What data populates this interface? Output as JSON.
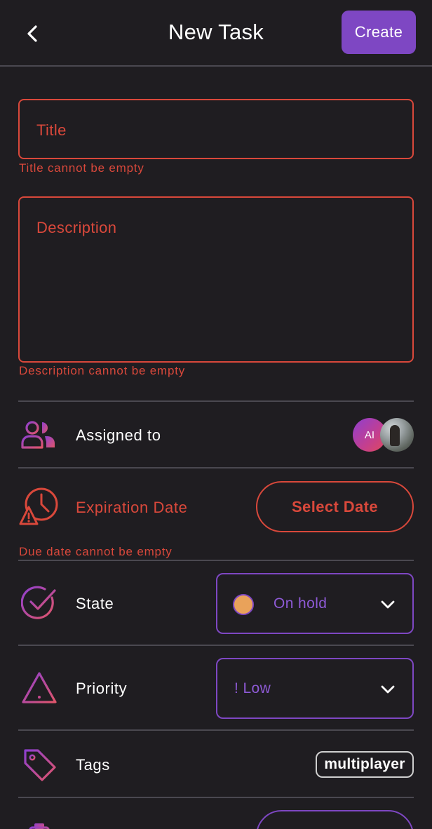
{
  "header": {
    "title": "New Task",
    "create_label": "Create"
  },
  "form": {
    "title_placeholder": "Title",
    "title_error": "Title cannot be empty",
    "description_placeholder": "Description",
    "description_error": "Description cannot be empty"
  },
  "assigned": {
    "label": "Assigned to",
    "avatar_initials": "AI"
  },
  "expiration": {
    "label": "Expiration Date",
    "button_label": "Select Date",
    "error": "Due date cannot be empty"
  },
  "state": {
    "label": "State",
    "value": "On hold",
    "dot_color": "#e9a25a"
  },
  "priority": {
    "label": "Priority",
    "value": "! Low"
  },
  "tags": {
    "label": "Tags",
    "items": [
      "multiplayer"
    ]
  },
  "colors": {
    "background": "#1f1d21",
    "accent": "#7e47c3",
    "error": "#d9483b",
    "divider": "#4a4850"
  },
  "icons": [
    "back-arrow-icon",
    "users-icon",
    "alarm-warning-icon",
    "check-circle-icon",
    "warning-triangle-icon",
    "tag-icon",
    "clipboard-icon",
    "chevron-down-icon"
  ]
}
